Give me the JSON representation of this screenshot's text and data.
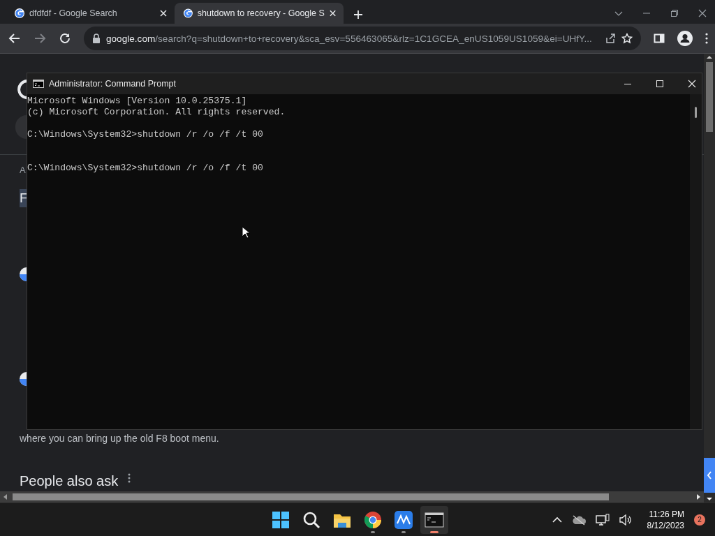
{
  "browser": {
    "tabs": [
      {
        "title": "dfdfdf - Google Search",
        "selected": false
      },
      {
        "title": "shutdown to recovery - Google S",
        "selected": true
      }
    ],
    "address": {
      "domain": "google.com",
      "path": "/search?q=shutdown+to+recovery&sca_esv=556463065&rlz=1C1GCEA_enUS1059US1059&ei=UHfY..."
    }
  },
  "page": {
    "items": [
      {
        "kind": "label",
        "text": "A"
      },
      {
        "kind": "highlight",
        "text": "F"
      },
      {
        "kind": "favicon"
      },
      {
        "kind": "favicon"
      },
      {
        "kind": "body",
        "text": "where you can bring up the old F8 boot menu."
      },
      {
        "kind": "heading",
        "text": "People also ask"
      }
    ]
  },
  "console": {
    "title": "Administrator: Command Prompt",
    "lines": [
      {
        "kind": "output",
        "text": "Microsoft Windows [Version 10.0.25375.1]"
      },
      {
        "kind": "output",
        "text": "(c) Microsoft Corporation. All rights reserved."
      },
      {
        "kind": "command",
        "text": "C:\\Windows\\System32>shutdown /r /o /f /t 00"
      },
      {
        "kind": "command",
        "text": "C:\\Windows\\System32>shutdown /r /o /f /t 00"
      }
    ]
  },
  "taskbar": {
    "apps": [
      {
        "kind": "start",
        "running": false,
        "selected": false
      },
      {
        "kind": "search",
        "running": false,
        "selected": false
      },
      {
        "kind": "files",
        "running": false,
        "selected": false
      },
      {
        "kind": "chrome",
        "running": true,
        "selected": false
      },
      {
        "kind": "chart",
        "running": true,
        "selected": false
      },
      {
        "kind": "terminal",
        "running": true,
        "selected": true
      }
    ],
    "time": "11:26 PM",
    "date": "8/12/2023",
    "notifications": "2"
  }
}
